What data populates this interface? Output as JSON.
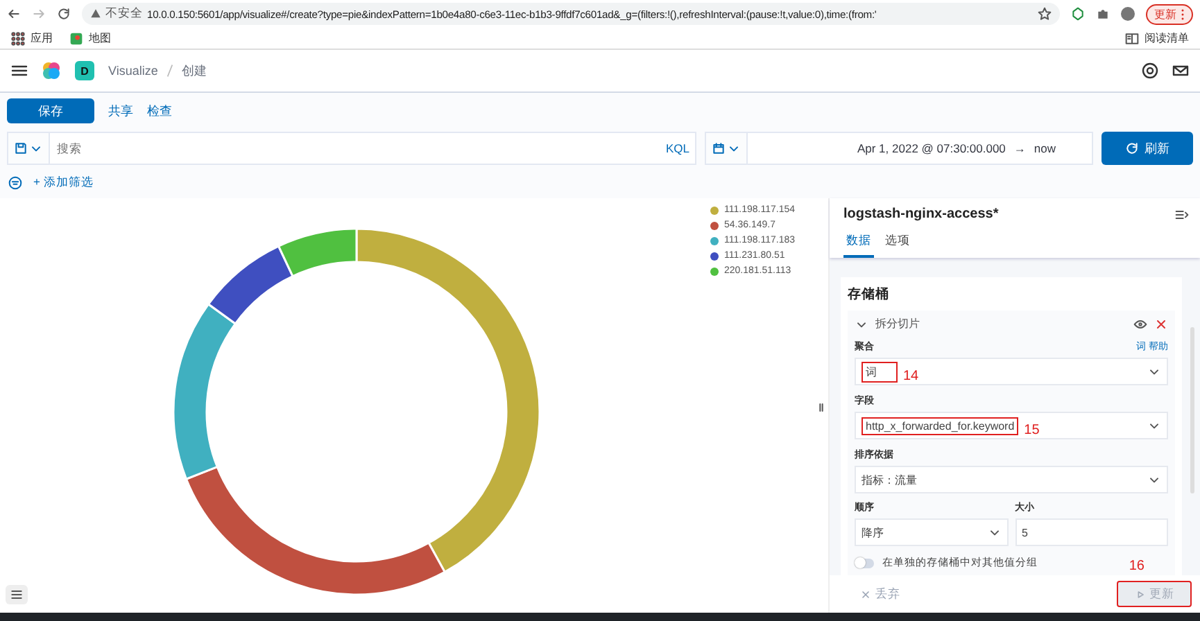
{
  "browser": {
    "security": "不安全",
    "url": "10.0.0.150:5601/app/visualize#/create?type=pie&indexPattern=1b0e4a80-c6e3-11ec-b1b3-9ffdf7c601ad&_g=(filters:!(),refreshInterval:(pause:!t,value:0),time:(from:'",
    "update_button": "更新",
    "bookmarks": [
      "应用",
      "地图"
    ],
    "reading_list": "阅读清单"
  },
  "app_header": {
    "space_badge": "D",
    "breadcrumbs": [
      "Visualize",
      "创建"
    ]
  },
  "toolbar": {
    "save": "保存",
    "links": [
      "共享",
      "检查"
    ]
  },
  "query_bar": {
    "placeholder": "搜索",
    "language": "KQL",
    "time_start": "Apr 1, 2022 @ 07:30:00.000",
    "arrow": "→",
    "time_end": "now",
    "refresh": "刷新"
  },
  "filter_bar": {
    "add_filter": "+ 添加筛选"
  },
  "legend": [
    {
      "label": "111.198.117.154",
      "color": "#c0af3f"
    },
    {
      "label": "54.36.149.7",
      "color": "#c05040"
    },
    {
      "label": "111.198.117.183",
      "color": "#40b0c0"
    },
    {
      "label": "111.231.80.51",
      "color": "#3f4fc0"
    },
    {
      "label": "220.181.51.113",
      "color": "#50c040"
    }
  ],
  "panel": {
    "title": "logstash-nginx-access*",
    "tabs": [
      {
        "label": "数据",
        "selected": true
      },
      {
        "label": "选项",
        "selected": false
      }
    ],
    "section_title": "存储桶",
    "bucket": {
      "title": "拆分切片",
      "aggregation_label": "聚合",
      "help_link": "词 帮助",
      "aggregation": "词",
      "field_label": "字段",
      "field": "http_x_forwarded_for.keyword",
      "order_by_label": "排序依据",
      "order_by": "指标：流量",
      "order_label": "顺序",
      "order": "降序",
      "size_label": "大小",
      "size": "5",
      "other_toggle": {
        "label": "在单独的存储桶中对其他值分组",
        "on": false
      }
    },
    "discard": "丢弃",
    "update": {
      "label": "更新",
      "disabled": true
    }
  },
  "annotations": [
    "14",
    "15",
    "16"
  ]
}
